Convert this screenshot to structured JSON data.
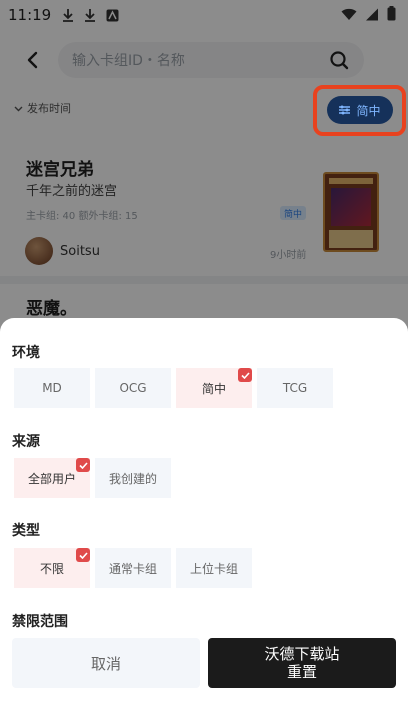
{
  "status_bar": {
    "time": "11:19"
  },
  "header": {
    "search_placeholder": "输入卡组ID・名称"
  },
  "filter": {
    "sort_label": "发布时间",
    "env_pill_label": "简中"
  },
  "cards": [
    {
      "title": "迷宫兄弟",
      "subtitle": "千年之前的迷宫",
      "meta": "主卡组: 40  额外卡组: 15",
      "tag": "简中",
      "author": "Soitsu",
      "time": "9小时前"
    },
    {
      "title": "恶魔。"
    }
  ],
  "sheet": {
    "sections": [
      {
        "title": "环境",
        "options": [
          "MD",
          "OCG",
          "简中",
          "TCG"
        ],
        "selected": "简中"
      },
      {
        "title": "来源",
        "options": [
          "全部用户",
          "我创建的"
        ],
        "selected": "全部用户"
      },
      {
        "title": "类型",
        "options": [
          "不限",
          "通常卡组",
          "上位卡组"
        ],
        "selected": "不限"
      },
      {
        "title": "禁限范围",
        "options": [],
        "selected": ""
      }
    ],
    "cancel_label": "取消",
    "reset_label": "重置",
    "watermark": "沃德下载站"
  },
  "colors": {
    "accent_red": "#e04a4a",
    "highlight_border": "#e8421f",
    "pill_bg": "#15315a",
    "pill_text": "#7fb6ff"
  }
}
